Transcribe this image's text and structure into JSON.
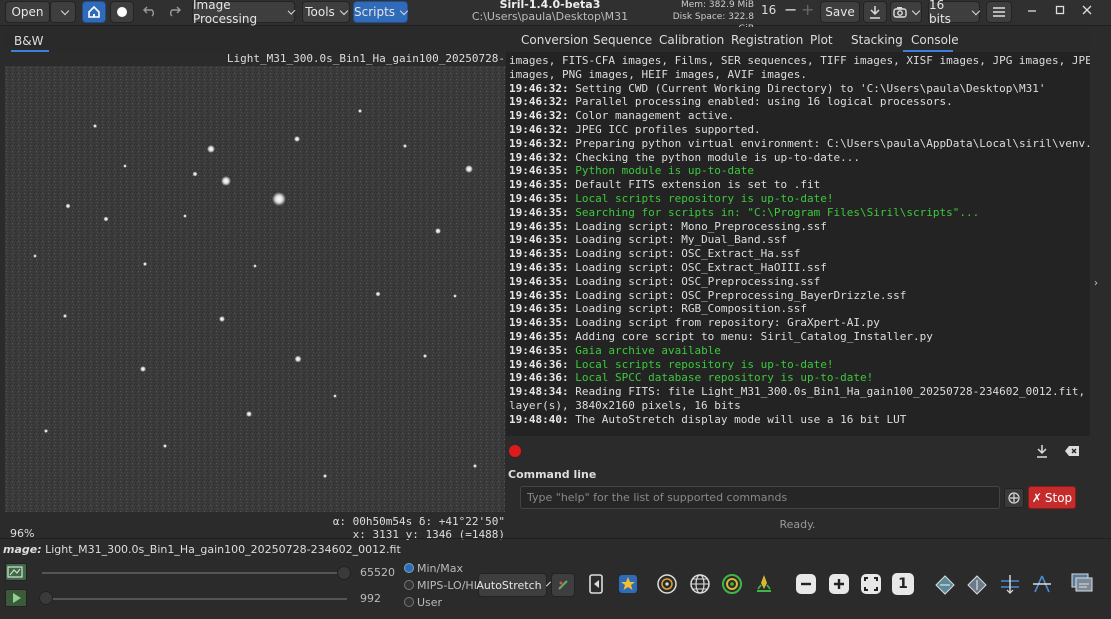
{
  "toolbar": {
    "open": "Open",
    "image_processing": "Image Processing",
    "tools": "Tools",
    "scripts": "Scripts",
    "app_title": "Siril-1.4.0-beta3",
    "path": "C:\\Users\\paula\\Desktop\\M31",
    "mem": "Mem: 382.9 MiB",
    "disk": "Disk Space: 322.8 GiB",
    "threads": "16",
    "save": "Save",
    "bits": "16 bits"
  },
  "viewer": {
    "tab": "B&W",
    "filename": "Light_M31_300.0s_Bin1_Ha_gain100_20250728-234602_0012.fit",
    "zoom": "96%",
    "coord_line1": "α: 00h50m54s δ: +41°22'50\"",
    "coord_line2": "x: 3131 y: 1346 (=1488)"
  },
  "tabs": [
    "Conversion",
    "Sequence",
    "Calibration",
    "Registration",
    "Plot",
    "Stacking",
    "Console"
  ],
  "console": {
    "lines": [
      {
        "t": "",
        "m": "images, FITS-CFA images, Films, SER sequences, TIFF images, XISF images, JPG images, JPEG XL",
        "c": "n"
      },
      {
        "t": "",
        "m": "images, PNG images, HEIF images, AVIF images.",
        "c": "n"
      },
      {
        "t": "19:46:32:",
        "m": "Setting CWD (Current Working Directory) to 'C:\\Users\\paula\\Desktop\\M31'",
        "c": "n"
      },
      {
        "t": "19:46:32:",
        "m": "Parallel processing enabled: using 16 logical processors.",
        "c": "n"
      },
      {
        "t": "19:46:32:",
        "m": "Color management active.",
        "c": "n"
      },
      {
        "t": "19:46:32:",
        "m": "JPEG ICC profiles supported.",
        "c": "n"
      },
      {
        "t": "19:46:32:",
        "m": "Preparing python virtual environment: C:\\Users\\paula\\AppData\\Local\\siril\\venv.",
        "c": "n"
      },
      {
        "t": "19:46:32:",
        "m": "Checking the python module is up-to-date...",
        "c": "n"
      },
      {
        "t": "19:46:35:",
        "m": "Python module is up-to-date",
        "c": "g"
      },
      {
        "t": "19:46:35:",
        "m": "Default FITS extension is set to .fit",
        "c": "n"
      },
      {
        "t": "19:46:35:",
        "m": "Local scripts repository is up-to-date!",
        "c": "g"
      },
      {
        "t": "19:46:35:",
        "m": "Searching for scripts in: \"C:\\Program Files\\Siril\\scripts\"...",
        "c": "g"
      },
      {
        "t": "19:46:35:",
        "m": "Loading script: Mono_Preprocessing.ssf",
        "c": "n"
      },
      {
        "t": "19:46:35:",
        "m": "Loading script: My_Dual_Band.ssf",
        "c": "n"
      },
      {
        "t": "19:46:35:",
        "m": "Loading script: OSC_Extract_Ha.ssf",
        "c": "n"
      },
      {
        "t": "19:46:35:",
        "m": "Loading script: OSC_Extract_HaOIII.ssf",
        "c": "n"
      },
      {
        "t": "19:46:35:",
        "m": "Loading script: OSC_Preprocessing.ssf",
        "c": "n"
      },
      {
        "t": "19:46:35:",
        "m": "Loading script: OSC_Preprocessing_BayerDrizzle.ssf",
        "c": "n"
      },
      {
        "t": "19:46:35:",
        "m": "Loading script: RGB_Composition.ssf",
        "c": "n"
      },
      {
        "t": "19:46:35:",
        "m": "Loading script from repository: GraXpert-AI.py",
        "c": "n"
      },
      {
        "t": "19:46:35:",
        "m": "Adding core script to menu: Siril_Catalog_Installer.py",
        "c": "n"
      },
      {
        "t": "19:46:35:",
        "m": "Gaia archive available",
        "c": "g"
      },
      {
        "t": "19:46:36:",
        "m": "Local scripts repository is up-to-date!",
        "c": "g"
      },
      {
        "t": "19:46:36:",
        "m": "Local SPCC database repository is up-to-date!",
        "c": "g"
      },
      {
        "t": "19:48:34:",
        "m": "Reading FITS: file Light_M31_300.0s_Bin1_Ha_gain100_20250728-234602_0012.fit, 1",
        "c": "n"
      },
      {
        "t": "",
        "m": "layer(s), 3840x2160 pixels, 16 bits",
        "c": "n"
      },
      {
        "t": "19:48:40:",
        "m": "The AutoStretch display mode will use a 16 bit LUT",
        "c": "n"
      }
    ]
  },
  "command": {
    "label": "Command line",
    "placeholder": "Type \"help\" for the list of supported commands",
    "stop": "Stop",
    "status": "Ready."
  },
  "bottom": {
    "image_label": "mage:",
    "image_name": "Light_M31_300.0s_Bin1_Ha_gain100_20250728-234602_0012.fit",
    "high": "65520",
    "low": "992",
    "radio_minmax": "Min/Max",
    "radio_mips": "MIPS-LO/HI",
    "radio_user": "User",
    "stretch": "AutoStretch",
    "one": "1"
  },
  "colors": {
    "accent": "#2f6bb8",
    "stop": "#c62b2b",
    "green_log": "#3cc83c"
  },
  "icons": [
    "home-icon",
    "circle-icon",
    "undo-icon",
    "redo-icon",
    "download-icon",
    "camera-icon",
    "menu-icon",
    "minimize-icon",
    "maximize-icon",
    "close-icon",
    "record-icon",
    "clear-icon",
    "stop-icon"
  ]
}
